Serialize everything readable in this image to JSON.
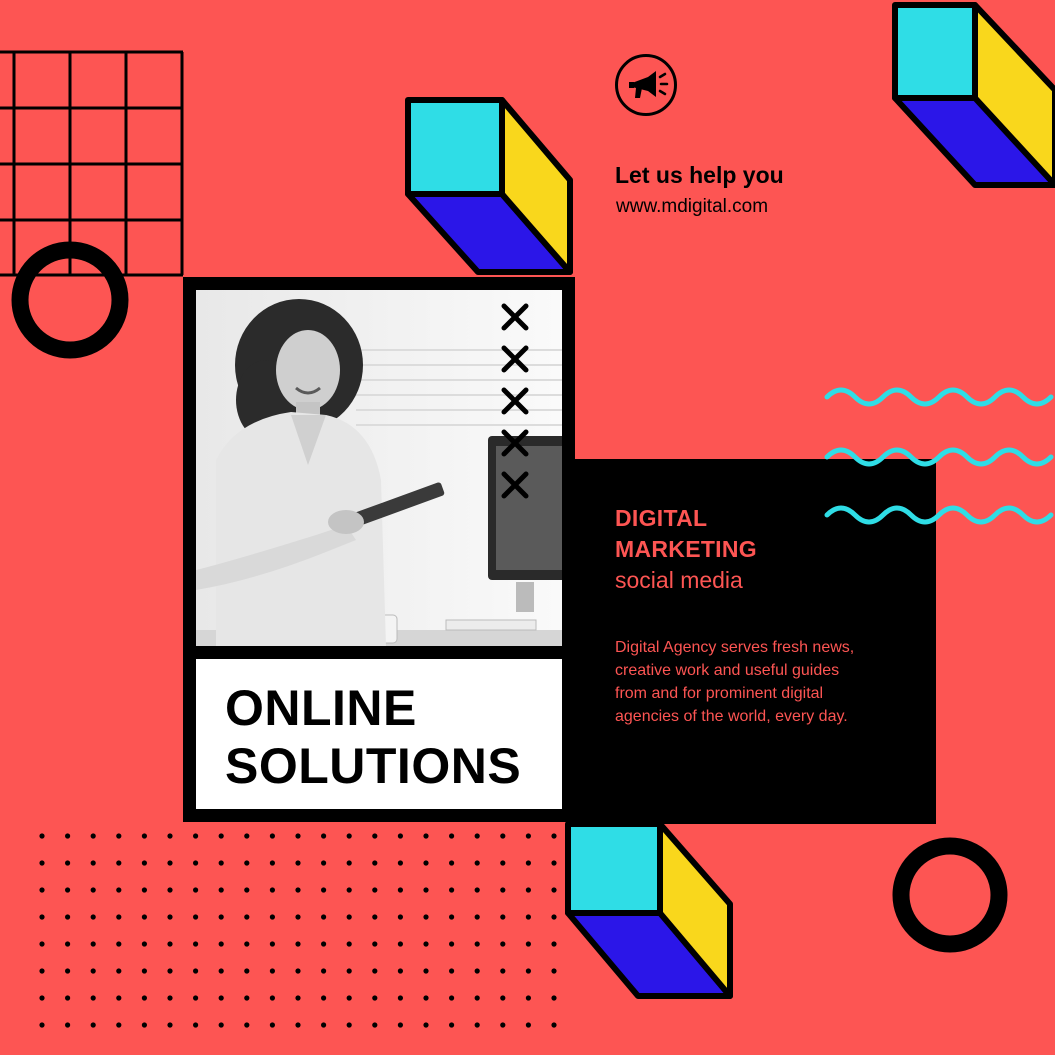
{
  "cta": {
    "title": "Let us help you",
    "url": "www.mdigital.com",
    "icon": "megaphone-icon"
  },
  "hero": {
    "caption_line1": "ONLINE",
    "caption_line2": "SOLUTIONS",
    "photo_icon": "woman-with-tablet-photo"
  },
  "info": {
    "title_line1": "DIGITAL",
    "title_line2": "MARKETING",
    "subtitle": "social media",
    "body": "Digital Agency serves fresh news, creative work and useful guides from and for prominent digital agencies of the world, every day."
  },
  "colors": {
    "background": "#fd5553",
    "cyan": "#2fdde6",
    "yellow": "#f9d71c",
    "blue": "#2b16e8",
    "black": "#000000",
    "white": "#ffffff"
  }
}
